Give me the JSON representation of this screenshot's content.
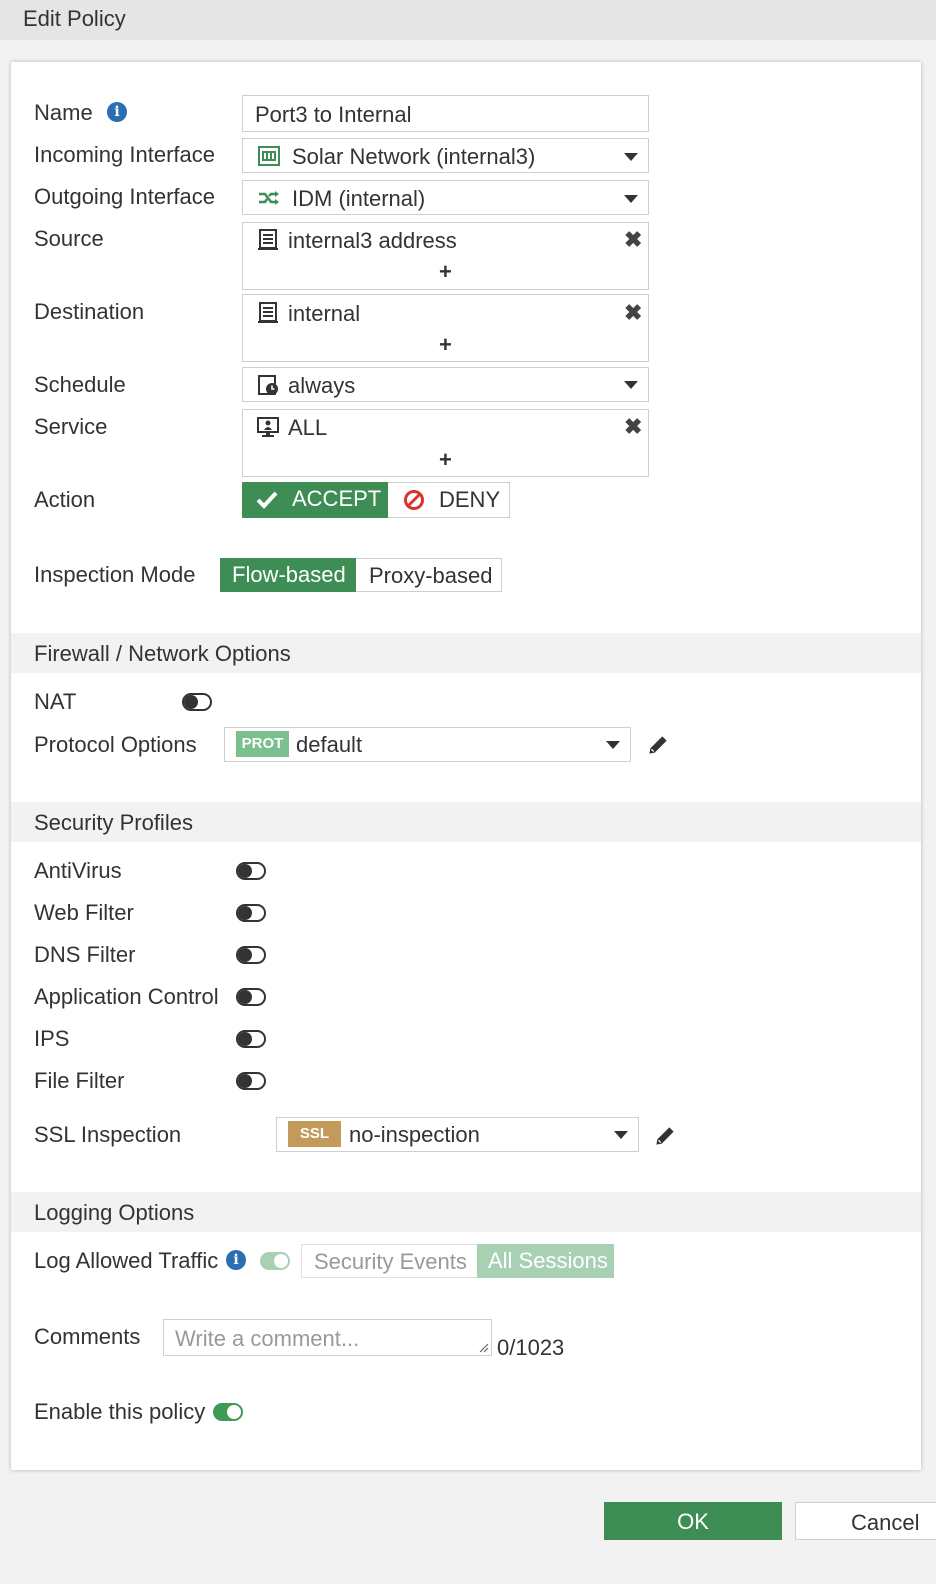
{
  "window": {
    "title": "Edit Policy"
  },
  "form": {
    "name_label": "Name",
    "name_value": "Port3 to Internal",
    "incoming_label": "Incoming Interface",
    "incoming_value": "Solar Network (internal3)",
    "outgoing_label": "Outgoing Interface",
    "outgoing_value": "IDM (internal)",
    "source_label": "Source",
    "source_value": "internal3 address",
    "destination_label": "Destination",
    "destination_value": "internal",
    "schedule_label": "Schedule",
    "schedule_value": "always",
    "service_label": "Service",
    "service_value": "ALL",
    "action_label": "Action",
    "action_accept": "ACCEPT",
    "action_deny": "DENY",
    "inspection_label": "Inspection Mode",
    "inspection_flow": "Flow-based",
    "inspection_proxy": "Proxy-based"
  },
  "firewall": {
    "title": "Firewall / Network Options",
    "nat_label": "NAT",
    "nat_enabled": false,
    "protocol_label": "Protocol Options",
    "protocol_badge": "PROT",
    "protocol_value": "default"
  },
  "security": {
    "title": "Security Profiles",
    "profiles": [
      {
        "label": "AntiVirus",
        "enabled": false
      },
      {
        "label": "Web Filter",
        "enabled": false
      },
      {
        "label": "DNS Filter",
        "enabled": false
      },
      {
        "label": "Application Control",
        "enabled": false
      },
      {
        "label": "IPS",
        "enabled": false
      },
      {
        "label": "File Filter",
        "enabled": false
      }
    ],
    "ssl_label": "SSL Inspection",
    "ssl_badge": "SSL",
    "ssl_value": "no-inspection"
  },
  "logging": {
    "title": "Logging Options",
    "log_label": "Log Allowed Traffic",
    "log_enabled": true,
    "opt_security": "Security Events",
    "opt_all": "All Sessions",
    "comments_label": "Comments",
    "comments_placeholder": "Write a comment...",
    "comments_count": "0/1023",
    "enable_label": "Enable this policy",
    "policy_enabled": true
  },
  "footer": {
    "ok_label": "OK",
    "cancel_label": "Cancel"
  },
  "colors": {
    "accent": "#3d8d55",
    "info": "#2a6fb1",
    "deny": "#d9342b",
    "ssl_badge": "#c49a5c",
    "prot_badge": "#7cbf8e"
  }
}
